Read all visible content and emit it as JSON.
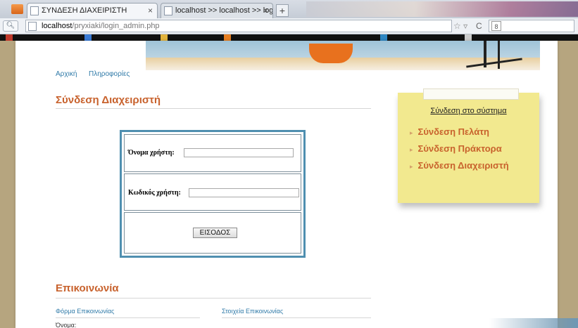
{
  "browser": {
    "tabs": [
      {
        "title": "ΣΥΝΔΕΣΗ ΔΙΑΧΕΙΡΙΣΤΗ",
        "close": "×"
      },
      {
        "title": "localhost >> localhost >> login >> l...",
        "close": "×"
      }
    ],
    "new_tab": "+",
    "url_host": "localhost",
    "url_path": "/pryxiaki/login_admin.php",
    "star": "☆ ▿",
    "reload": "C",
    "search_engine_glyph": "8"
  },
  "menu": {
    "home": "Αρχική",
    "info": "Πληροφορίες"
  },
  "page_title": "Σύνδεση Διαχειριστή",
  "form": {
    "username_label": "Όνομα χρήστη:",
    "password_label": "Κωδικός χρήστη:",
    "username_value": "",
    "password_value": "",
    "submit_label": "ΕΙΣΟΔΟΣ"
  },
  "sidebar": {
    "heading": "Σύνδεση στο σύστημα",
    "bullet": "▸",
    "items": [
      "Σύνδεση Πελάτη",
      "Σύνδεση Πράκτορα",
      "Σύνδεση Διαχειριστή"
    ]
  },
  "contact": {
    "title": "Επικοινωνία",
    "form_heading": "Φόρμα Επικοινωνίας",
    "info_heading": "Στοιχεία Επικοινωνίας",
    "name_label": "Όνομα:"
  },
  "colors": {
    "accent": "#c8622d",
    "link": "#2f7aa8",
    "note": "#f2e98f",
    "frame": "#4f8fb0"
  }
}
